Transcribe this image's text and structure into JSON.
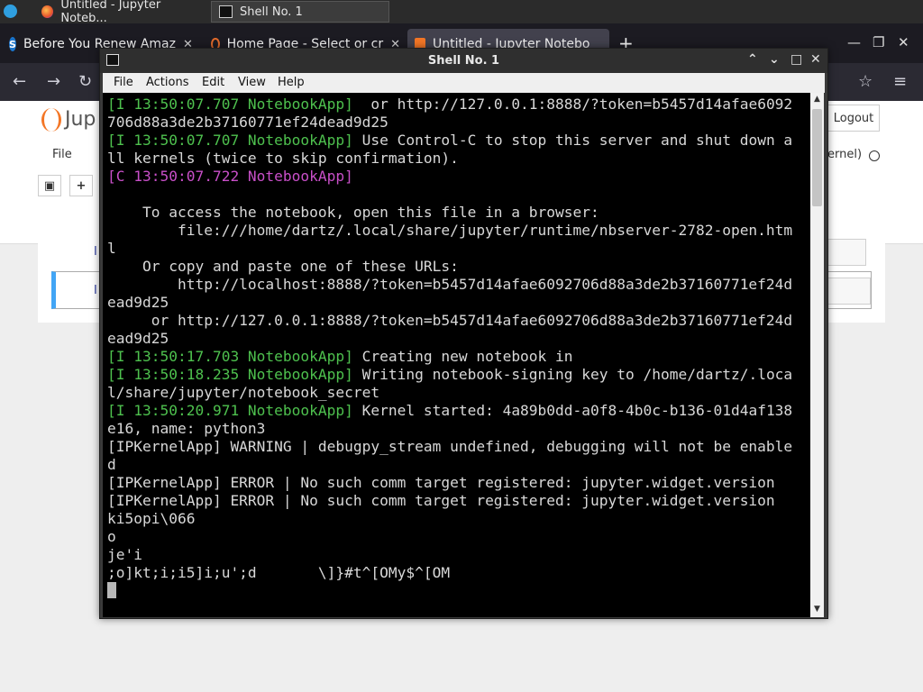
{
  "taskbar": {
    "tasks": [
      {
        "label": "Untitled - Jupyter Noteb..."
      },
      {
        "label": "Shell No. 1"
      }
    ]
  },
  "browser": {
    "tabs": [
      {
        "label": "Before You Renew Amaz"
      },
      {
        "label": "Home Page - Select or cr"
      },
      {
        "label": "Untitled - Jupyter Notebo"
      }
    ],
    "new_tab": "+"
  },
  "jupyter": {
    "logo_text": "Jup",
    "logout_label": "Logout",
    "menu_file": "File",
    "kernel_status": "ernel)",
    "cell_prompt_1": "I",
    "cell_prompt_2": "I"
  },
  "terminal": {
    "title": "Shell No. 1",
    "menu": [
      "File",
      "Actions",
      "Edit",
      "View",
      "Help"
    ],
    "lines": {
      "l1_tag": "[I 13:50:07.707 NotebookApp]",
      "l1_text": "  or http://127.0.0.1:8888/?token=b5457d14afae6092",
      "l2": "706d88a3de2b37160771ef24dead9d25",
      "l3_tag": "[I 13:50:07.707 NotebookApp]",
      "l3_text": " Use Control-C to stop this server and shut down a",
      "l4": "ll kernels (twice to skip confirmation).",
      "l5_tag": "[C 13:50:07.722 NotebookApp]",
      "l6": "",
      "l7": "    To access the notebook, open this file in a browser:",
      "l8": "        file:///home/dartz/.local/share/jupyter/runtime/nbserver-2782-open.htm",
      "l9": "l",
      "l10": "    Or copy and paste one of these URLs:",
      "l11": "        http://localhost:8888/?token=b5457d14afae6092706d88a3de2b37160771ef24d",
      "l12": "ead9d25",
      "l13": "     or http://127.0.0.1:8888/?token=b5457d14afae6092706d88a3de2b37160771ef24d",
      "l14": "ead9d25",
      "l15_tag": "[I 13:50:17.703 NotebookApp]",
      "l15_text": " Creating new notebook in",
      "l16_tag": "[I 13:50:18.235 NotebookApp]",
      "l16_text": " Writing notebook-signing key to /home/dartz/.loca",
      "l17": "l/share/jupyter/notebook_secret",
      "l18_tag": "[I 13:50:20.971 NotebookApp]",
      "l18_text": " Kernel started: 4a89b0dd-a0f8-4b0c-b136-01d4af138",
      "l19": "e16, name: python3",
      "l20": "[IPKernelApp] WARNING | debugpy_stream undefined, debugging will not be enable",
      "l21": "d",
      "l22": "[IPKernelApp] ERROR | No such comm target registered: jupyter.widget.version",
      "l23": "[IPKernelApp] ERROR | No such comm target registered: jupyter.widget.version",
      "l24": "ki5opi\\066",
      "l25": "o",
      "l26": "je'i",
      "l27": ";o]kt;i;i5]i;u';d       \\]}#t^[OMy$^[OM"
    }
  },
  "colors": {
    "log_green": "#4ec14e",
    "log_magenta": "#c84fc8",
    "terminal_bg": "#000000",
    "jupyter_orange": "#f37626"
  }
}
